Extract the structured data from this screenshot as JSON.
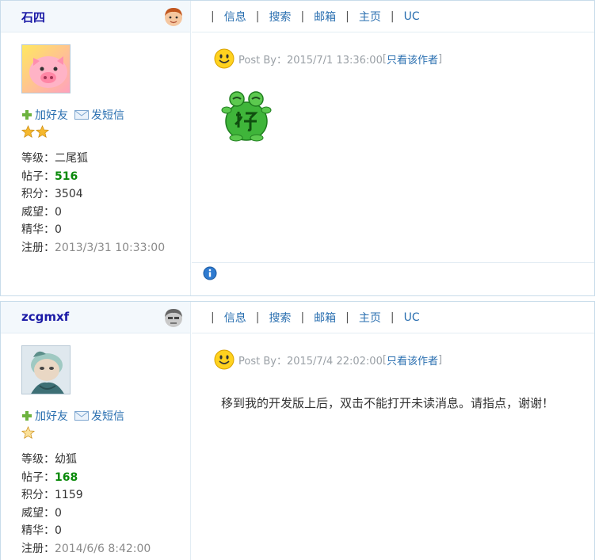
{
  "nav": {
    "items": [
      "信息",
      "搜索",
      "邮箱",
      "主页",
      "UC"
    ],
    "separator": "|"
  },
  "posts": [
    {
      "username": "石四",
      "actions": {
        "add_friend": "加好友",
        "send_message": "发短信"
      },
      "star_count": 2,
      "stats": {
        "level_label": "等级：",
        "level": "二尾狐",
        "posts_label": "帖子：",
        "posts": "516",
        "points_label": "积分：",
        "points": "3504",
        "prestige_label": "威望：",
        "prestige": "0",
        "essence_label": "精华：",
        "essence": "0",
        "registered_label": "注册：",
        "registered": "2013/3/31 10:33:00"
      },
      "post_by": "Post By：2015/7/1 13:36:00",
      "only_author": "只看该作者",
      "body_emoticon": "frog-good-emoticon"
    },
    {
      "username": "zcgmxf",
      "actions": {
        "add_friend": "加好友",
        "send_message": "发短信"
      },
      "star_count": 1,
      "stats": {
        "level_label": "等级：",
        "level": "幼狐",
        "posts_label": "帖子：",
        "posts": "168",
        "points_label": "积分：",
        "points": "1159",
        "prestige_label": "威望：",
        "prestige": "0",
        "essence_label": "精华：",
        "essence": "0",
        "registered_label": "注册：",
        "registered": "2014/6/6 8:42:00"
      },
      "post_by": "Post By：2015/7/4 22:02:00",
      "only_author": "只看该作者",
      "message": "移到我的开发版上后，双击不能打开未读消息。请指点，谢谢！"
    }
  ],
  "icons": {
    "add": "plus-icon",
    "mail": "envelope-icon",
    "star": "star-icon",
    "smile": "smile-icon",
    "info": "info-icon"
  },
  "colors": {
    "link": "#2a6fb0",
    "username": "#1a1aa6",
    "highlight_number": "#0a8a0a",
    "border": "#c8dcea"
  }
}
